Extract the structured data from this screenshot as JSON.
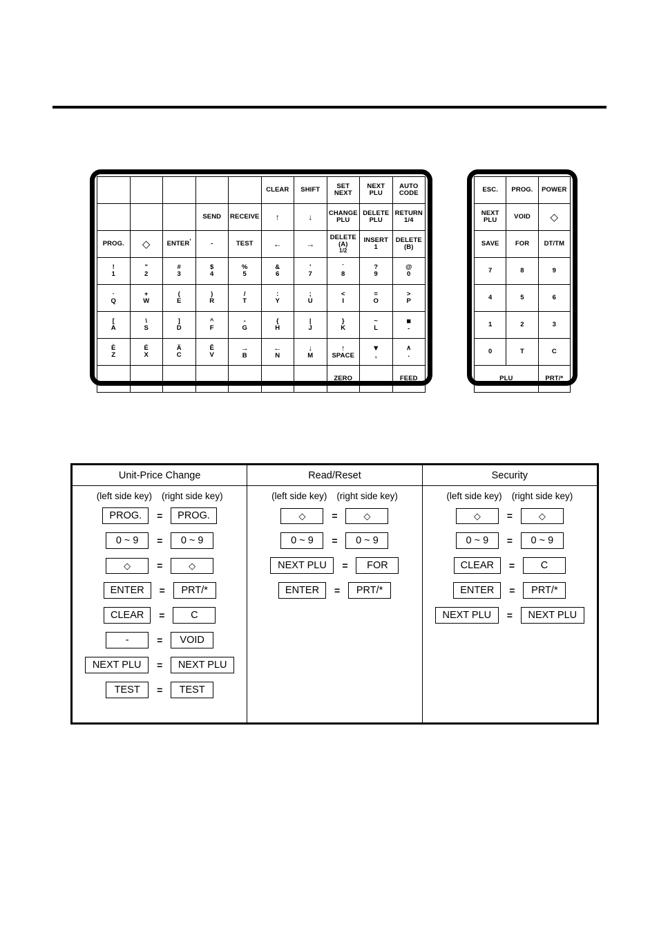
{
  "page": {
    "has_header_rule": true
  },
  "left_keyboard": {
    "name": "left-side-keyboard",
    "rows": [
      [
        {
          "blank": true
        },
        {
          "blank": true
        },
        {
          "blank": true
        },
        {
          "blank": true
        },
        {
          "blank": true
        },
        {
          "top": "CLEAR"
        },
        {
          "top": "SHIFT"
        },
        {
          "top": "SET",
          "bot": "NEXT"
        },
        {
          "top": "NEXT",
          "bot": "PLU"
        },
        {
          "top": "AUTO",
          "bot": "CODE"
        }
      ],
      [
        {
          "blank": true
        },
        {
          "blank": true
        },
        {
          "blank": true
        },
        {
          "top": "SEND"
        },
        {
          "top": "RECEIVE"
        },
        {
          "top": "↑",
          "style": "arrow"
        },
        {
          "top": "↓",
          "style": "arrow"
        },
        {
          "top": "CHANGE",
          "bot": "PLU"
        },
        {
          "top": "DELETE",
          "bot": "PLU"
        },
        {
          "top": "RETURN",
          "bot": "1/4"
        }
      ],
      [
        {
          "top": "PROG."
        },
        {
          "top": "◇",
          "style": "diamond"
        },
        {
          "top": "ENTER",
          "style": "enter-tick"
        },
        {
          "top": "-"
        },
        {
          "top": "TEST"
        },
        {
          "top": "←",
          "style": "arrow"
        },
        {
          "top": "→",
          "style": "arrow"
        },
        {
          "top": "DELETE",
          "bot": "(A)",
          "bot2": "1/2"
        },
        {
          "top": "INSERT",
          "bot": "1"
        },
        {
          "top": "DELETE",
          "bot": "(B)"
        }
      ],
      [
        {
          "top": "!",
          "bot": "1"
        },
        {
          "top": "\"",
          "bot": "2"
        },
        {
          "top": "#",
          "bot": "3"
        },
        {
          "top": "$",
          "bot": "4"
        },
        {
          "top": "%",
          "bot": "5"
        },
        {
          "top": "&",
          "bot": "6"
        },
        {
          "top": "’",
          "bot": "7"
        },
        {
          "top": "`",
          "bot": "8"
        },
        {
          "top": "?",
          "bot": "9"
        },
        {
          "top": "@",
          "bot": "0"
        }
      ],
      [
        {
          "top": "·",
          "bot": "Q"
        },
        {
          "top": "+",
          "bot": "W"
        },
        {
          "top": "(",
          "bot": "E"
        },
        {
          "top": ")",
          "bot": "R"
        },
        {
          "top": "/",
          "bot": "T"
        },
        {
          "top": ":",
          "bot": "Y"
        },
        {
          "top": ";",
          "bot": "U"
        },
        {
          "top": "<",
          "bot": "I"
        },
        {
          "top": "=",
          "bot": "O"
        },
        {
          "top": ">",
          "bot": "P"
        }
      ],
      [
        {
          "top": "[",
          "bot": "A"
        },
        {
          "top": "\\",
          "bot": "S"
        },
        {
          "top": "]",
          "bot": "D"
        },
        {
          "top": "^",
          "bot": "F"
        },
        {
          "top": "-",
          "bot": "G"
        },
        {
          "top": "{",
          "bot": "H"
        },
        {
          "top": "|",
          "bot": "J"
        },
        {
          "top": "}",
          "bot": "K"
        },
        {
          "top": "~",
          "bot": "L"
        },
        {
          "top": "■",
          "bot": "-",
          "style": "block"
        }
      ],
      [
        {
          "top": "È",
          "bot": "Z"
        },
        {
          "top": "É",
          "bot": "X"
        },
        {
          "top": "Ä",
          "bot": "C"
        },
        {
          "top": "Ê",
          "bot": "V"
        },
        {
          "top": "→",
          "bot": "B",
          "style": "arrow-sm"
        },
        {
          "top": "←",
          "bot": "N",
          "style": "arrow-sm"
        },
        {
          "top": "↓",
          "bot": "M",
          "style": "arrow-sm"
        },
        {
          "top": "↑",
          "bot": "SPACE",
          "style": "arrow-sm"
        },
        {
          "top": "▼",
          "bot": ",",
          "style": "block"
        },
        {
          "top": "∧",
          "bot": "."
        }
      ],
      [
        {
          "blank": true
        },
        {
          "blank": true
        },
        {
          "blank": true
        },
        {
          "blank": true
        },
        {
          "blank": true
        },
        {
          "blank": true
        },
        {
          "blank": true
        },
        {
          "top": "ZERO"
        },
        {
          "blank": true
        },
        {
          "top": "FEED"
        }
      ]
    ]
  },
  "right_keypad": {
    "name": "right-side-keypad",
    "rows": [
      [
        {
          "top": "ESC."
        },
        {
          "top": "PROG."
        },
        {
          "top": "POWER"
        }
      ],
      [
        {
          "top": "NEXT",
          "bot": "PLU"
        },
        {
          "top": "VOID"
        },
        {
          "top": "◇",
          "style": "diamond"
        }
      ],
      [
        {
          "top": "SAVE"
        },
        {
          "top": "FOR"
        },
        {
          "top": "DT/TM"
        }
      ],
      [
        {
          "top": "7"
        },
        {
          "top": "8"
        },
        {
          "top": "9"
        }
      ],
      [
        {
          "top": "4"
        },
        {
          "top": "5"
        },
        {
          "top": "6"
        }
      ],
      [
        {
          "top": "1"
        },
        {
          "top": "2"
        },
        {
          "top": "3"
        }
      ],
      [
        {
          "top": "0"
        },
        {
          "top": "T"
        },
        {
          "top": "C"
        }
      ],
      [
        {
          "top": "PLU",
          "colspan": 2
        },
        {
          "top": "PRT/*"
        }
      ]
    ]
  },
  "reference_table": {
    "subhead_left": "(left side key)",
    "subhead_right": "(right side key)",
    "equals": "=",
    "columns": [
      {
        "title": "Unit-Price Change",
        "rows": [
          {
            "left": "PROG.",
            "right": "PROG."
          },
          {
            "left": "0 ~ 9",
            "right": "0 ~ 9"
          },
          {
            "left": "◇",
            "right": "◇",
            "style": "diamond"
          },
          {
            "left": "ENTER",
            "right": "PRT/*"
          },
          {
            "left": "CLEAR",
            "right": "C"
          },
          {
            "left": "-",
            "right": "VOID"
          },
          {
            "left": "NEXT PLU",
            "right": "NEXT PLU",
            "wide": true
          },
          {
            "left": "TEST",
            "right": "TEST"
          }
        ]
      },
      {
        "title": "Read/Reset",
        "rows": [
          {
            "left": "◇",
            "right": "◇",
            "style": "diamond"
          },
          {
            "left": "0 ~ 9",
            "right": "0 ~ 9"
          },
          {
            "left": "NEXT PLU",
            "right": "FOR",
            "wide_left": true
          },
          {
            "left": "ENTER",
            "right": "PRT/*"
          }
        ]
      },
      {
        "title": "Security",
        "rows": [
          {
            "left": "◇",
            "right": "◇",
            "style": "diamond"
          },
          {
            "left": "0 ~ 9",
            "right": "0 ~ 9"
          },
          {
            "left": "CLEAR",
            "right": "C"
          },
          {
            "left": "ENTER",
            "right": "PRT/*"
          },
          {
            "left": "NEXT PLU",
            "right": "NEXT PLU",
            "wide": true
          }
        ]
      }
    ]
  }
}
